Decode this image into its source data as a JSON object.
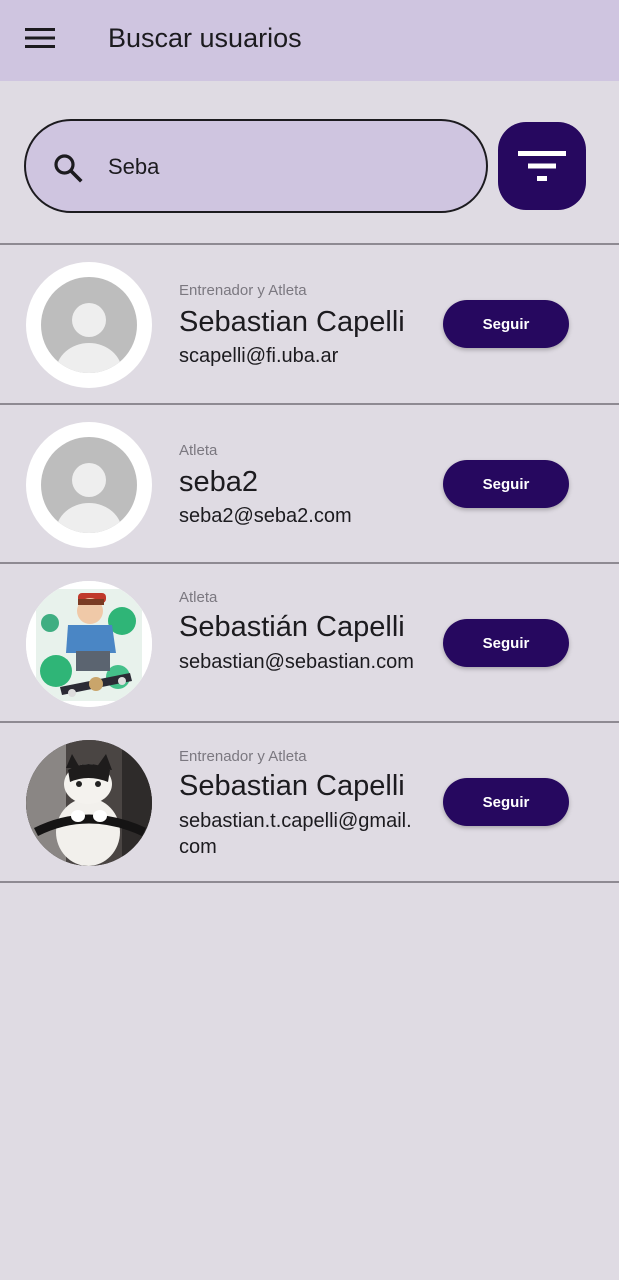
{
  "app_bar": {
    "menu_icon": "hamburger-menu-icon",
    "title": "Buscar usuarios"
  },
  "search": {
    "icon": "search-icon",
    "value": "Seba",
    "filter_icon": "filter-icon"
  },
  "colors": {
    "app_bar_bg": "#cfc5e0",
    "page_bg": "#dfdbe3",
    "accent": "#26085f"
  },
  "users": [
    {
      "role": "Entrenador y Atleta",
      "name": "Sebastian Capelli",
      "email": "scapelli@fi.uba.ar",
      "avatar": "default-avatar",
      "follow_label": "Seguir"
    },
    {
      "role": "Atleta",
      "name": "seba2",
      "email": "seba2@seba2.com",
      "avatar": "default-avatar",
      "follow_label": "Seguir"
    },
    {
      "role": "Atleta",
      "name": "Sebastián Capelli",
      "email": "sebastian@sebastian.com",
      "avatar": "anime-skateboarder-photo",
      "follow_label": "Seguir"
    },
    {
      "role": "Entrenador y Atleta",
      "name": "Sebastian Capelli",
      "email": "sebastian.t.capelli@gmail.com",
      "avatar": "cat-photo",
      "follow_label": "Seguir"
    }
  ]
}
